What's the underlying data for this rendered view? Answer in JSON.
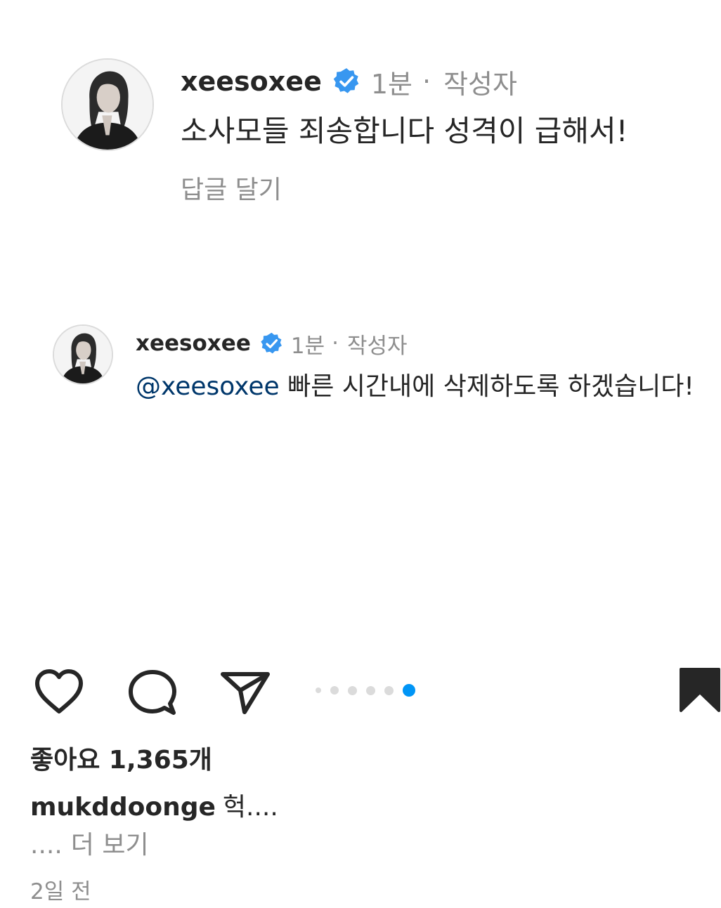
{
  "comments": [
    {
      "username": "xeesoxee",
      "time": "1분",
      "separator": "·",
      "author_badge": "작성자",
      "text": "소사모들 죄송합니다 성격이 급해서!",
      "reply_label": "답글 달기"
    },
    {
      "username": "xeesoxee",
      "time": "1분",
      "separator": "·",
      "author_badge": "작성자",
      "mention": "@xeesoxee",
      "text": " 빠른 시간내에 삭제하도록 하겠습니다!"
    }
  ],
  "carousel": {
    "count": 6,
    "active_index": 5
  },
  "post": {
    "likes": "좋아요 1,365개",
    "caption_user": "mukddoonge",
    "caption_text": "헉....",
    "caption_more_prefix": "....",
    "more_label": "더 보기",
    "timestamp": "2일 전"
  },
  "colors": {
    "verified": "#3897f0",
    "active_dot": "#0095f6",
    "inactive_dot": "#dbdbdb",
    "mention": "#00376b",
    "secondary_text": "#8e8e8e"
  },
  "icons": [
    "heart-icon",
    "comment-icon",
    "share-icon",
    "bookmark-icon",
    "verified-badge-icon"
  ]
}
